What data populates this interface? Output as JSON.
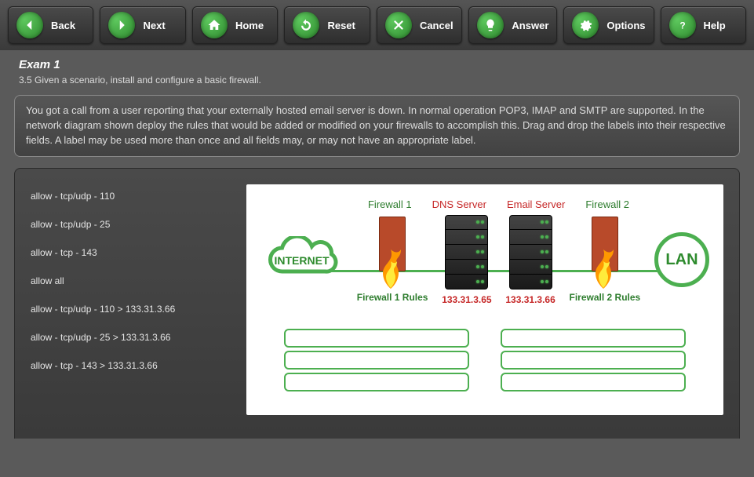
{
  "toolbar": {
    "back": "Back",
    "next": "Next",
    "home": "Home",
    "reset": "Reset",
    "cancel": "Cancel",
    "answer": "Answer",
    "options": "Options",
    "help": "Help"
  },
  "exam": {
    "title": "Exam 1",
    "objective": "3.5 Given a scenario, install and configure a basic firewall."
  },
  "scenario": "You got a call from a user reporting that your externally hosted email server is down. In normal operation POP3, IMAP and SMTP are supported. In the network diagram shown deploy the rules that would be added or modified on your firewalls to accomplish this. Drag and drop the labels into their respective fields. A label may be used more than once and all fields may, or may not have an appropriate label.",
  "drag_labels": [
    "allow - tcp/udp - 110",
    "allow - tcp/udp - 25",
    "allow - tcp - 143",
    "allow all",
    "allow - tcp/udp - 110 > 133.31.3.66",
    "allow - tcp/udp - 25 > 133.31.3.66",
    "allow - tcp - 143 > 133.31.3.66"
  ],
  "diagram": {
    "internet": "INTERNET",
    "firewall1": "Firewall 1",
    "dns": "DNS Server",
    "dns_ip": "133.31.3.65",
    "email": "Email Server",
    "email_ip": "133.31.3.66",
    "firewall2": "Firewall 2",
    "lan": "LAN",
    "fw1_rules": "Firewall 1 Rules",
    "fw2_rules": "Firewall 2 Rules"
  }
}
